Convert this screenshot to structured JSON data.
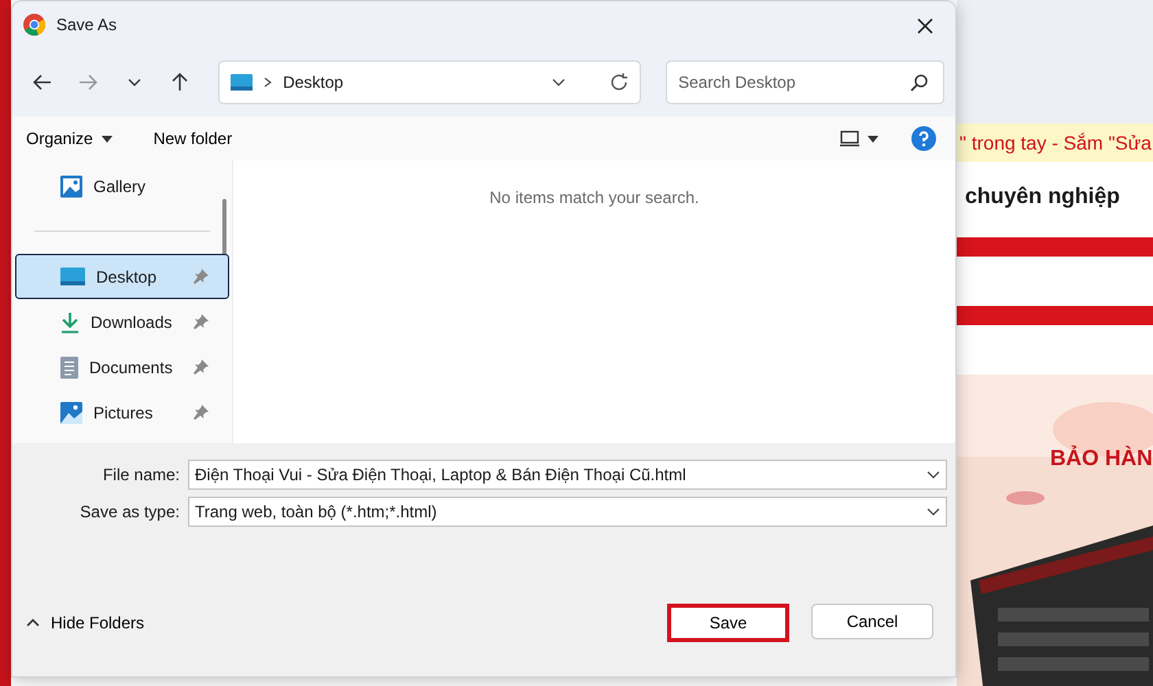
{
  "window": {
    "title": "Save As"
  },
  "nav": {
    "address": "Desktop",
    "search_placeholder": "Search Desktop"
  },
  "toolbar": {
    "organize": "Organize",
    "new_folder": "New folder"
  },
  "sidebar": {
    "items": [
      {
        "label": "Gallery",
        "kind": "gallery",
        "pinned": false,
        "selected": false
      },
      {
        "label": "Desktop",
        "kind": "desktop",
        "pinned": true,
        "selected": true
      },
      {
        "label": "Downloads",
        "kind": "downloads",
        "pinned": true,
        "selected": false
      },
      {
        "label": "Documents",
        "kind": "documents",
        "pinned": true,
        "selected": false
      },
      {
        "label": "Pictures",
        "kind": "pictures",
        "pinned": true,
        "selected": false
      }
    ]
  },
  "content": {
    "empty_message": "No items match your search."
  },
  "fields": [
    {
      "label": "File name:",
      "value": "Điện Thoại Vui - Sửa Điện Thoại, Laptop & Bán Điện Thoại Cũ.html"
    },
    {
      "label": "Save as type:",
      "value": "Trang web, toàn bộ (*.htm;*.html)"
    }
  ],
  "hide_folders": "Hide Folders",
  "buttons": [
    {
      "label": "Save",
      "highlighted": true
    },
    {
      "label": "Cancel",
      "highlighted": false
    }
  ],
  "background_page": {
    "banner": "\" trong tay - Sắm \"Sửa",
    "heading": "chuyên nghiệp",
    "promo": "BẢO HÀN"
  }
}
